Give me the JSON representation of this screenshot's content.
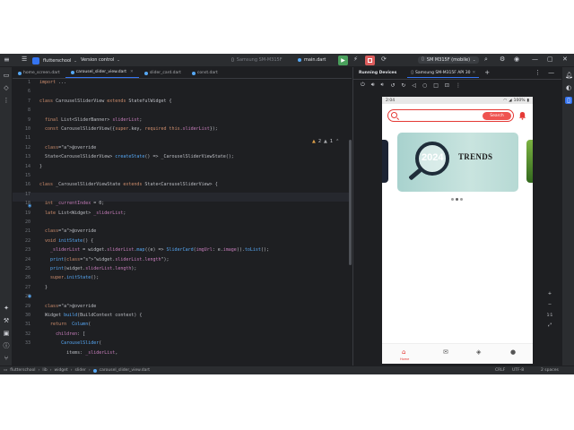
{
  "titlebar": {
    "project_initial": "F",
    "project_name": "flutterschool",
    "vcs_label": "Version control",
    "device_selector": "Samsung SM-M315F",
    "run_config": "main.dart",
    "running_device": "SM M315F (mobile)"
  },
  "tabs": [
    {
      "label": "home_screen.dart",
      "active": false
    },
    {
      "label": "carousel_slider_view.dart",
      "active": true
    },
    {
      "label": "slider_card.dart",
      "active": false
    },
    {
      "label": "const.dart",
      "active": false
    }
  ],
  "editor": {
    "inspection_counts": {
      "warnings": "2",
      "weak": "1"
    },
    "line_numbers": [
      "1",
      "6",
      "7",
      "8",
      "9",
      "10",
      "11",
      "12",
      "13",
      "14",
      "15",
      "16",
      "17",
      "18",
      "19",
      "20",
      "21",
      "22",
      "23",
      "24",
      "25",
      "26",
      "27",
      "28",
      "29",
      "30",
      "31",
      "32",
      "33"
    ],
    "lines": [
      "import ...",
      "",
      "class CarouselSliderView extends StatefulWidget {",
      "",
      "  final List<SliderBanner> sliderList;",
      "  const CarouselSliderView({super.key, required this.sliderList});",
      "",
      "  @override",
      "  State<CarouselSliderView> createState() => _CarouselSliderViewState();",
      "}",
      "",
      "class _CarouselSliderViewState extends State<CarouselSliderView> {",
      "",
      "  int _currentIndex = 0;",
      "  late List<Widget> _sliderList;",
      "",
      "  @override",
      "  void initState() {",
      "    _sliderList = widget.sliderList.map((e) => SliderCard(imgUrl: e.image)).toList();",
      "    print(\"widget.sliderList.length\");",
      "    print(widget.sliderList.length);",
      "    super.initState();",
      "  }",
      "",
      "  @override",
      "  Widget build(BuildContext context) {",
      "    return  Column(",
      "      children: [",
      "        CarouselSlider("
    ],
    "last_line": "          items: _sliderList,"
  },
  "running_devices": {
    "title": "Running Devices",
    "device_tab": "Samsung SM-M315F API 30"
  },
  "phone": {
    "time": "2:04",
    "battery": "100%",
    "search_button": "Search",
    "banner_year": "2024",
    "banner_word": "TRENDS",
    "slide_count": 3,
    "active_slide": 2,
    "nav_home_label": "Home"
  },
  "zoom_label": "1:1",
  "statusbar": {
    "breadcrumb": [
      "flutterschool",
      "lib",
      "widget",
      "slider",
      "carousel_slider_view.dart"
    ],
    "line_ending": "CRLF",
    "encoding": "UTF-8",
    "indent": "2 spaces"
  },
  "colors": {
    "ide_bg": "#1e1f22",
    "ide_panel": "#2b2d30",
    "accent": "#3574f0",
    "run": "#4aa05c",
    "stop": "#db5c5c",
    "app_red": "#e53935"
  }
}
